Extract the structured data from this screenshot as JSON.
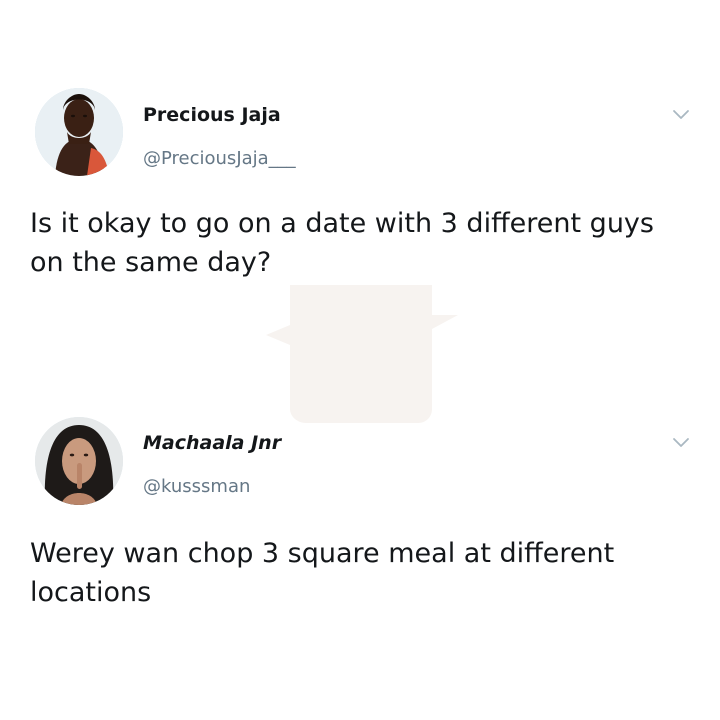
{
  "tweets": [
    {
      "display_name": "Precious Jaja",
      "handle": "@PreciousJaja___",
      "text": "Is it okay to go on a date with 3 different guys on the same day?",
      "avatar_icon": "profile-photo",
      "menu_icon": "chevron-down-icon"
    },
    {
      "display_name": "Machaala Jnr",
      "handle": "@kusssman",
      "text": "Werey wan chop 3 square meal at different locations",
      "avatar_icon": "profile-photo",
      "menu_icon": "chevron-down-icon"
    }
  ],
  "colors": {
    "background": "#ffffff",
    "name": "#14171a",
    "handle": "#657786",
    "chevron": "#aab8c2"
  }
}
